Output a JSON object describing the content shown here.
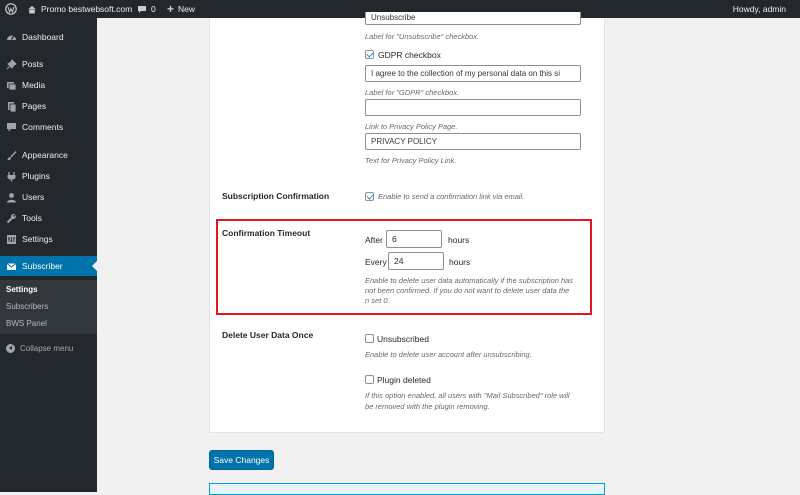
{
  "adminbar": {
    "site_name": "Promo bestwebsoft.com",
    "comments_count": "0",
    "new_label": "New",
    "greeting": "Howdy, admin"
  },
  "sidebar": {
    "items": [
      {
        "label": "Dashboard",
        "icon": "dashboard-icon"
      },
      {
        "label": "Posts",
        "icon": "pin-icon"
      },
      {
        "label": "Media",
        "icon": "media-icon"
      },
      {
        "label": "Pages",
        "icon": "pages-icon"
      },
      {
        "label": "Comments",
        "icon": "comment-icon"
      },
      {
        "label": "Appearance",
        "icon": "brush-icon"
      },
      {
        "label": "Plugins",
        "icon": "plug-icon"
      },
      {
        "label": "Users",
        "icon": "user-icon"
      },
      {
        "label": "Tools",
        "icon": "wrench-icon"
      },
      {
        "label": "Settings",
        "icon": "settings-icon"
      },
      {
        "label": "Subscriber",
        "icon": "envelope-icon"
      }
    ],
    "submenu": [
      "Settings",
      "Subscribers",
      "BWS Panel"
    ],
    "collapse": "Collapse menu"
  },
  "form": {
    "unsubscribe_value": "Unsubscribe",
    "unsubscribe_desc": "Label for \"Unsubscribe\" checkbox.",
    "gdpr_checkbox_label": "GDPR checkbox",
    "gdpr_value": "I agree to the collection of my personal data on this si",
    "gdpr_desc": "Label for \"GDPR\" checkbox.",
    "privacy_link_value": "",
    "privacy_link_desc": "Link to Privacy Policy Page.",
    "privacy_text_value": "PRIVACY POLICY",
    "privacy_text_desc": "Text for Privacy Policy Link.",
    "confirmation_label": "Subscription Confirmation",
    "confirmation_desc": "Enable to send a confirmation link via email.",
    "timeout_label": "Confirmation Timeout",
    "after_label": "After",
    "after_value": "6",
    "after_unit": "hours",
    "every_label": "Every",
    "every_value": "24",
    "every_unit": "hours",
    "timeout_desc_1": "Enable to delete user data automatically if the subscription has",
    "timeout_desc_2": "not been confirmed. If you do not want to delete user data the",
    "timeout_desc_3": "n set 0.",
    "delete_label": "Delete User Data Once",
    "unsubscribed_label": "Unsubscribed",
    "unsubscribed_desc": "Enable to delete user account after unsubscribing.",
    "plugin_deleted_label": "Plugin deleted",
    "plugin_deleted_desc_1": "If this option enabled, all users with \"Mail Subscribed\" role will",
    "plugin_deleted_desc_2": "be removed with the plugin removing."
  },
  "save_label": "Save Changes",
  "colors": {
    "admin_bar": "#23282d",
    "accent": "#0073aa",
    "highlight": "#e4151f"
  }
}
